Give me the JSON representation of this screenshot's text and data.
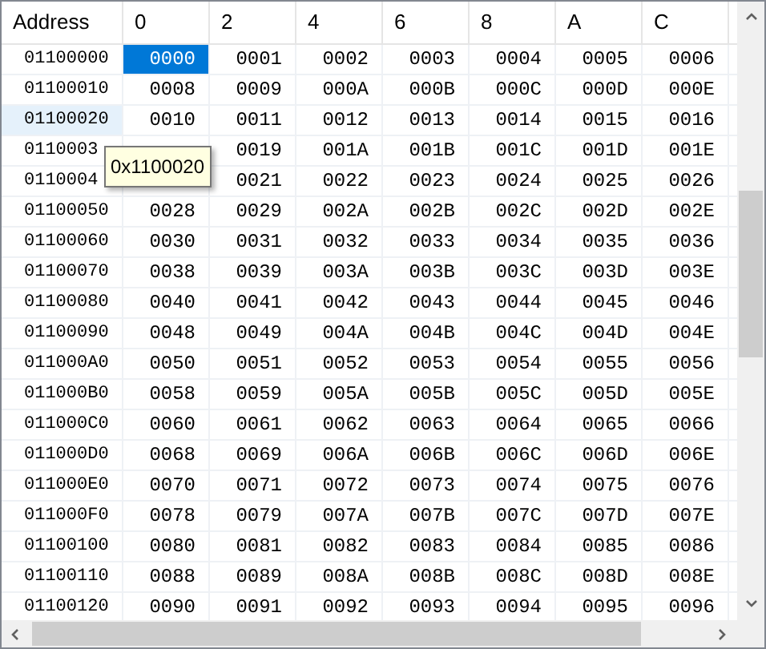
{
  "columns": [
    "Address",
    "0",
    "2",
    "4",
    "6",
    "8",
    "A",
    "C"
  ],
  "rows": [
    {
      "address": "01100000",
      "highlighted": false,
      "cells": [
        {
          "text": "0000",
          "selected": true
        },
        {
          "text": "0001",
          "selected": false
        },
        {
          "text": "0002",
          "selected": false
        },
        {
          "text": "0003",
          "selected": false
        },
        {
          "text": "0004",
          "selected": false
        },
        {
          "text": "0005",
          "selected": false
        },
        {
          "text": "0006",
          "selected": false
        }
      ]
    },
    {
      "address": "01100010",
      "highlighted": false,
      "cells": [
        {
          "text": "0008",
          "selected": false
        },
        {
          "text": "0009",
          "selected": false
        },
        {
          "text": "000A",
          "selected": false
        },
        {
          "text": "000B",
          "selected": false
        },
        {
          "text": "000C",
          "selected": false
        },
        {
          "text": "000D",
          "selected": false
        },
        {
          "text": "000E",
          "selected": false
        }
      ]
    },
    {
      "address": "01100020",
      "highlighted": true,
      "cells": [
        {
          "text": "0010",
          "selected": false
        },
        {
          "text": "0011",
          "selected": false
        },
        {
          "text": "0012",
          "selected": false
        },
        {
          "text": "0013",
          "selected": false
        },
        {
          "text": "0014",
          "selected": false
        },
        {
          "text": "0015",
          "selected": false
        },
        {
          "text": "0016",
          "selected": false
        }
      ]
    },
    {
      "address": "0110003",
      "highlighted": false,
      "cells": [
        null,
        {
          "text": "0019",
          "selected": false
        },
        {
          "text": "001A",
          "selected": false
        },
        {
          "text": "001B",
          "selected": false
        },
        {
          "text": "001C",
          "selected": false
        },
        {
          "text": "001D",
          "selected": false
        },
        {
          "text": "001E",
          "selected": false
        }
      ]
    },
    {
      "address": "0110004",
      "highlighted": false,
      "cells": [
        null,
        {
          "text": "0021",
          "selected": false
        },
        {
          "text": "0022",
          "selected": false
        },
        {
          "text": "0023",
          "selected": false
        },
        {
          "text": "0024",
          "selected": false
        },
        {
          "text": "0025",
          "selected": false
        },
        {
          "text": "0026",
          "selected": false
        }
      ]
    },
    {
      "address": "01100050",
      "highlighted": false,
      "cells": [
        {
          "text": "0028",
          "selected": false
        },
        {
          "text": "0029",
          "selected": false
        },
        {
          "text": "002A",
          "selected": false
        },
        {
          "text": "002B",
          "selected": false
        },
        {
          "text": "002C",
          "selected": false
        },
        {
          "text": "002D",
          "selected": false
        },
        {
          "text": "002E",
          "selected": false
        }
      ]
    },
    {
      "address": "01100060",
      "highlighted": false,
      "cells": [
        {
          "text": "0030",
          "selected": false
        },
        {
          "text": "0031",
          "selected": false
        },
        {
          "text": "0032",
          "selected": false
        },
        {
          "text": "0033",
          "selected": false
        },
        {
          "text": "0034",
          "selected": false
        },
        {
          "text": "0035",
          "selected": false
        },
        {
          "text": "0036",
          "selected": false
        }
      ]
    },
    {
      "address": "01100070",
      "highlighted": false,
      "cells": [
        {
          "text": "0038",
          "selected": false
        },
        {
          "text": "0039",
          "selected": false
        },
        {
          "text": "003A",
          "selected": false
        },
        {
          "text": "003B",
          "selected": false
        },
        {
          "text": "003C",
          "selected": false
        },
        {
          "text": "003D",
          "selected": false
        },
        {
          "text": "003E",
          "selected": false
        }
      ]
    },
    {
      "address": "01100080",
      "highlighted": false,
      "cells": [
        {
          "text": "0040",
          "selected": false
        },
        {
          "text": "0041",
          "selected": false
        },
        {
          "text": "0042",
          "selected": false
        },
        {
          "text": "0043",
          "selected": false
        },
        {
          "text": "0044",
          "selected": false
        },
        {
          "text": "0045",
          "selected": false
        },
        {
          "text": "0046",
          "selected": false
        }
      ]
    },
    {
      "address": "01100090",
      "highlighted": false,
      "cells": [
        {
          "text": "0048",
          "selected": false
        },
        {
          "text": "0049",
          "selected": false
        },
        {
          "text": "004A",
          "selected": false
        },
        {
          "text": "004B",
          "selected": false
        },
        {
          "text": "004C",
          "selected": false
        },
        {
          "text": "004D",
          "selected": false
        },
        {
          "text": "004E",
          "selected": false
        }
      ]
    },
    {
      "address": "011000A0",
      "highlighted": false,
      "cells": [
        {
          "text": "0050",
          "selected": false
        },
        {
          "text": "0051",
          "selected": false
        },
        {
          "text": "0052",
          "selected": false
        },
        {
          "text": "0053",
          "selected": false
        },
        {
          "text": "0054",
          "selected": false
        },
        {
          "text": "0055",
          "selected": false
        },
        {
          "text": "0056",
          "selected": false
        }
      ]
    },
    {
      "address": "011000B0",
      "highlighted": false,
      "cells": [
        {
          "text": "0058",
          "selected": false
        },
        {
          "text": "0059",
          "selected": false
        },
        {
          "text": "005A",
          "selected": false
        },
        {
          "text": "005B",
          "selected": false
        },
        {
          "text": "005C",
          "selected": false
        },
        {
          "text": "005D",
          "selected": false
        },
        {
          "text": "005E",
          "selected": false
        }
      ]
    },
    {
      "address": "011000C0",
      "highlighted": false,
      "cells": [
        {
          "text": "0060",
          "selected": false
        },
        {
          "text": "0061",
          "selected": false
        },
        {
          "text": "0062",
          "selected": false
        },
        {
          "text": "0063",
          "selected": false
        },
        {
          "text": "0064",
          "selected": false
        },
        {
          "text": "0065",
          "selected": false
        },
        {
          "text": "0066",
          "selected": false
        }
      ]
    },
    {
      "address": "011000D0",
      "highlighted": false,
      "cells": [
        {
          "text": "0068",
          "selected": false
        },
        {
          "text": "0069",
          "selected": false
        },
        {
          "text": "006A",
          "selected": false
        },
        {
          "text": "006B",
          "selected": false
        },
        {
          "text": "006C",
          "selected": false
        },
        {
          "text": "006D",
          "selected": false
        },
        {
          "text": "006E",
          "selected": false
        }
      ]
    },
    {
      "address": "011000E0",
      "highlighted": false,
      "cells": [
        {
          "text": "0070",
          "selected": false
        },
        {
          "text": "0071",
          "selected": false
        },
        {
          "text": "0072",
          "selected": false
        },
        {
          "text": "0073",
          "selected": false
        },
        {
          "text": "0074",
          "selected": false
        },
        {
          "text": "0075",
          "selected": false
        },
        {
          "text": "0076",
          "selected": false
        }
      ]
    },
    {
      "address": "011000F0",
      "highlighted": false,
      "cells": [
        {
          "text": "0078",
          "selected": false
        },
        {
          "text": "0079",
          "selected": false
        },
        {
          "text": "007A",
          "selected": false
        },
        {
          "text": "007B",
          "selected": false
        },
        {
          "text": "007C",
          "selected": false
        },
        {
          "text": "007D",
          "selected": false
        },
        {
          "text": "007E",
          "selected": false
        }
      ]
    },
    {
      "address": "01100100",
      "highlighted": false,
      "cells": [
        {
          "text": "0080",
          "selected": false
        },
        {
          "text": "0081",
          "selected": false
        },
        {
          "text": "0082",
          "selected": false
        },
        {
          "text": "0083",
          "selected": false
        },
        {
          "text": "0084",
          "selected": false
        },
        {
          "text": "0085",
          "selected": false
        },
        {
          "text": "0086",
          "selected": false
        }
      ]
    },
    {
      "address": "01100110",
      "highlighted": false,
      "cells": [
        {
          "text": "0088",
          "selected": false
        },
        {
          "text": "0089",
          "selected": false
        },
        {
          "text": "008A",
          "selected": false
        },
        {
          "text": "008B",
          "selected": false
        },
        {
          "text": "008C",
          "selected": false
        },
        {
          "text": "008D",
          "selected": false
        },
        {
          "text": "008E",
          "selected": false
        }
      ]
    },
    {
      "address": "01100120",
      "highlighted": false,
      "cells": [
        {
          "text": "0090",
          "selected": false
        },
        {
          "text": "0091",
          "selected": false
        },
        {
          "text": "0092",
          "selected": false
        },
        {
          "text": "0093",
          "selected": false
        },
        {
          "text": "0094",
          "selected": false
        },
        {
          "text": "0095",
          "selected": false
        },
        {
          "text": "0096",
          "selected": false
        }
      ]
    }
  ],
  "tooltip": {
    "text": "0x1100020"
  }
}
